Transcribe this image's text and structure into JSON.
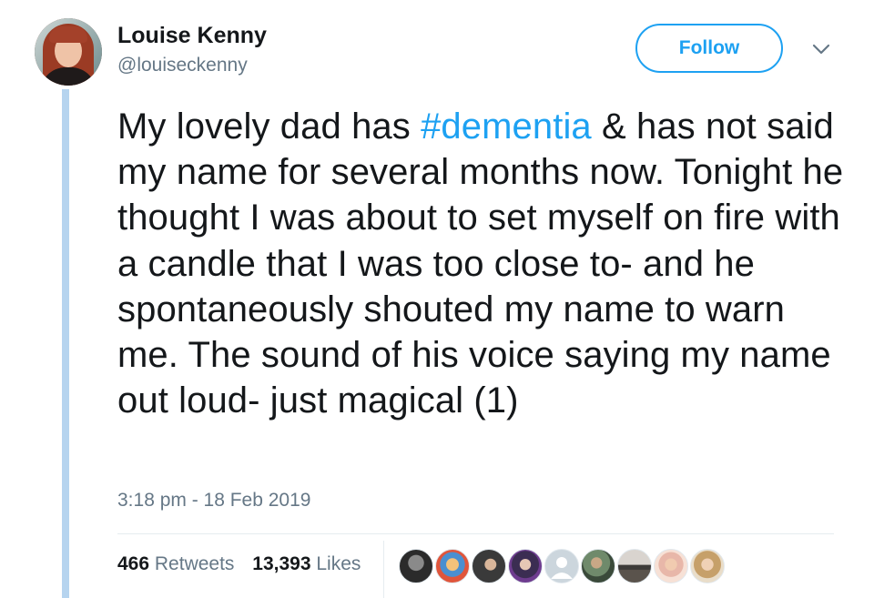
{
  "author": {
    "name": "Louise Kenny",
    "handle": "@louiseckenny"
  },
  "follow_button": {
    "label": "Follow"
  },
  "tweet": {
    "text_before": "My lovely dad has ",
    "hashtag": "#dementia",
    "text_after": " & has not said my name for several months now. Tonight he thought I was about to set myself on fire with a candle that I was too close to- and he spontaneously shouted my name to warn me. The sound of his voice saying my name out loud- just magical (1)"
  },
  "timestamp": "3:18 pm - 18 Feb 2019",
  "stats": {
    "retweets_count": "466",
    "retweets_label": "Retweets",
    "likes_count": "13,393",
    "likes_label": "Likes"
  },
  "colors": {
    "link_blue": "#1da1f2",
    "thread_line": "#b6d4ef",
    "secondary_text": "#657786"
  },
  "liker_avatars": [
    "liker-avatar-1",
    "liker-avatar-2",
    "liker-avatar-3",
    "liker-avatar-4",
    "liker-avatar-5",
    "liker-avatar-6",
    "liker-avatar-7",
    "liker-avatar-8",
    "liker-avatar-9"
  ]
}
